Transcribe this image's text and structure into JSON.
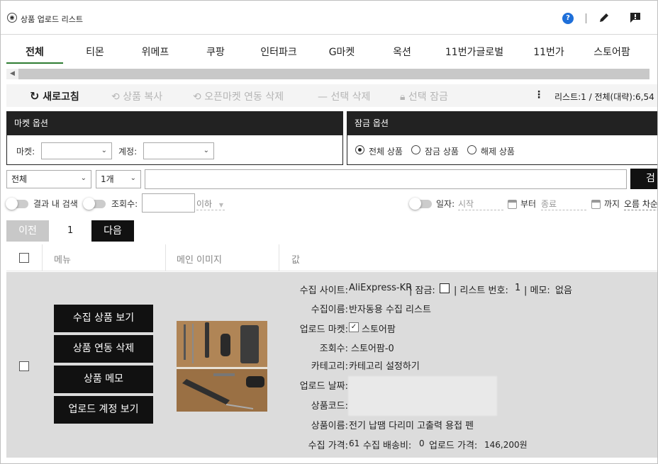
{
  "header": {
    "title": "상품 업로드 리스트",
    "logo_icon": "logo-icon",
    "help": "?",
    "icons": [
      "help-icon",
      "pencil-icon",
      "feedback-icon"
    ]
  },
  "tabs": [
    {
      "label": "전체",
      "active": true
    },
    {
      "label": "티몬"
    },
    {
      "label": "위메프"
    },
    {
      "label": "쿠팡"
    },
    {
      "label": "인터파크"
    },
    {
      "label": "G마켓"
    },
    {
      "label": "옥션"
    },
    {
      "label": "11번가글로벌"
    },
    {
      "label": "11번가"
    },
    {
      "label": "스토어팜"
    }
  ],
  "toolbar": {
    "refresh": "새로고침",
    "copy": "상품 복사",
    "open_delete": "오픈마켓 연동 삭제",
    "select_delete": "선택 삭제",
    "select_lock": "선택 잠금",
    "more": "⋮",
    "list_info": "리스트:1  /  전체(대략):6,54"
  },
  "market_options": {
    "title": "마켓 옵션",
    "market_label": "마켓:",
    "account_label": "계정:",
    "market_value": "",
    "account_value": ""
  },
  "lock_options": {
    "title": "잠금 옵션",
    "options": [
      "전체 상품",
      "잠금 상품",
      "해제 상품"
    ],
    "selected": 0
  },
  "search": {
    "scope": "전체",
    "count": "1개",
    "query": "",
    "button": "검"
  },
  "filters": {
    "in_result": "결과 내 검색",
    "views_label": "조회수:",
    "views_value": "",
    "below": "이하",
    "date_label": "일자:",
    "start": "시작",
    "from": "부터",
    "end": "종료",
    "until": "까지",
    "sort": "오름 차순"
  },
  "pager": {
    "prev": "이전",
    "page": "1",
    "next": "다음"
  },
  "table": {
    "headers": [
      "메뉴",
      "메인 이미지",
      "값"
    ]
  },
  "row": {
    "buttons": [
      "수집 상품 보기",
      "상품 연동 삭제",
      "상품 메모",
      "업로드 계정 보기"
    ],
    "fields": {
      "site_label": "수집 사이트:",
      "site": "AliExpress-KR",
      "lock_label": "| 잠금:",
      "list_no_label": "| 리스트 번호:",
      "list_no": "1",
      "memo_label": "| 메모:",
      "memo": "없음",
      "name_label": "수집이름:",
      "name": "반자동용 수집 리스트",
      "market_label": "업로드 마켓:",
      "market": "스토어팜",
      "views_label": "조회수:",
      "views": "스토어팜-0",
      "category_label": "카테고리:",
      "category": "카테고리 설정하기",
      "date_label": "업로드 날짜:",
      "code_label": "상품코드:",
      "product_label": "상품이름:",
      "product": "전기 납땜 다리미 고출력 용접 펜",
      "price_label": "수집 가격:",
      "price": "61",
      "shipping_label": "수집 배송비:",
      "shipping": "0",
      "upload_price_label": "업로드 가격:",
      "upload_price": "146,200원"
    }
  },
  "colors": {
    "accent": "#2e7d32",
    "dark": "#222222",
    "help": "#1e6fd9"
  }
}
